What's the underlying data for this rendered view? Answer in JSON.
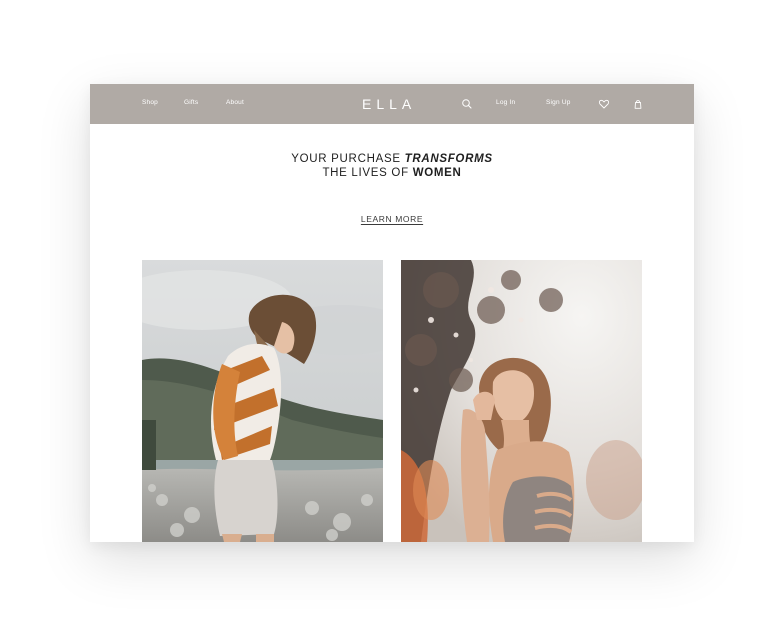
{
  "nav": {
    "links": [
      "Shop",
      "Gifts",
      "About"
    ],
    "logo": "ELLA",
    "login_label": "Log In",
    "signup_label": "Sign Up",
    "icons": [
      "search-icon",
      "heart-icon",
      "shopping-bag-icon"
    ],
    "background_color": "#b0aaa5"
  },
  "hero": {
    "line1_prefix": "YOUR PURCHASE ",
    "line1_emphasis": "TRANSFORMS",
    "line2_prefix": "THE LIVES OF ",
    "line2_emphasis": "WOMEN",
    "cta_label": "LEARN MORE"
  }
}
